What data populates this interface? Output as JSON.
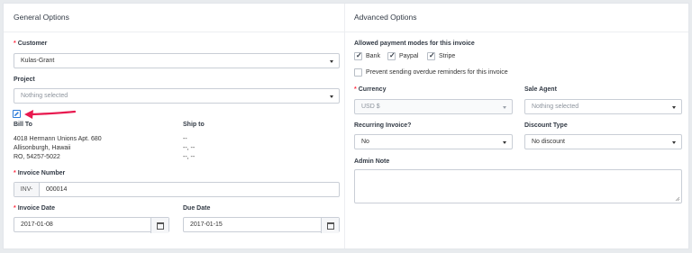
{
  "general": {
    "title": "General Options",
    "customer_label": "Customer",
    "customer_value": "Kulas-Grant",
    "project_label": "Project",
    "project_placeholder": "Nothing selected",
    "bill_to_label": "Bill To",
    "bill_to_lines": [
      "4018 Hermann Unions Apt. 680",
      "Allisonburgh, Hawaii",
      "RO, 54257-5022"
    ],
    "ship_to_label": "Ship to",
    "ship_to_lines": [
      "--",
      "--, --",
      "--, --"
    ],
    "invoice_number_label": "Invoice Number",
    "invoice_prefix": "INV-",
    "invoice_number_value": "000014",
    "invoice_date_label": "Invoice Date",
    "invoice_date_value": "2017-01-08",
    "due_date_label": "Due Date",
    "due_date_value": "2017-01-15"
  },
  "advanced": {
    "title": "Advanced Options",
    "payment_modes_label": "Allowed payment modes for this invoice",
    "payment_modes": [
      {
        "label": "Bank",
        "checked": true
      },
      {
        "label": "Paypal",
        "checked": true
      },
      {
        "label": "Stripe",
        "checked": true
      }
    ],
    "prevent_reminders_label": "Prevent sending overdue reminders for this invoice",
    "currency_label": "Currency",
    "currency_value": "USD $",
    "sale_agent_label": "Sale Agent",
    "sale_agent_placeholder": "Nothing selected",
    "recurring_label": "Recurring Invoice?",
    "recurring_value": "No",
    "discount_type_label": "Discount Type",
    "discount_type_value": "No discount",
    "admin_note_label": "Admin Note"
  },
  "colors": {
    "required": "#ff2d42",
    "arrow": "#e8194f",
    "edit_icon": "#2b7bd9"
  },
  "icons": [
    "edit-icon",
    "calendar-icon",
    "check-icon",
    "chevron-down-icon",
    "arrow-annotation"
  ]
}
